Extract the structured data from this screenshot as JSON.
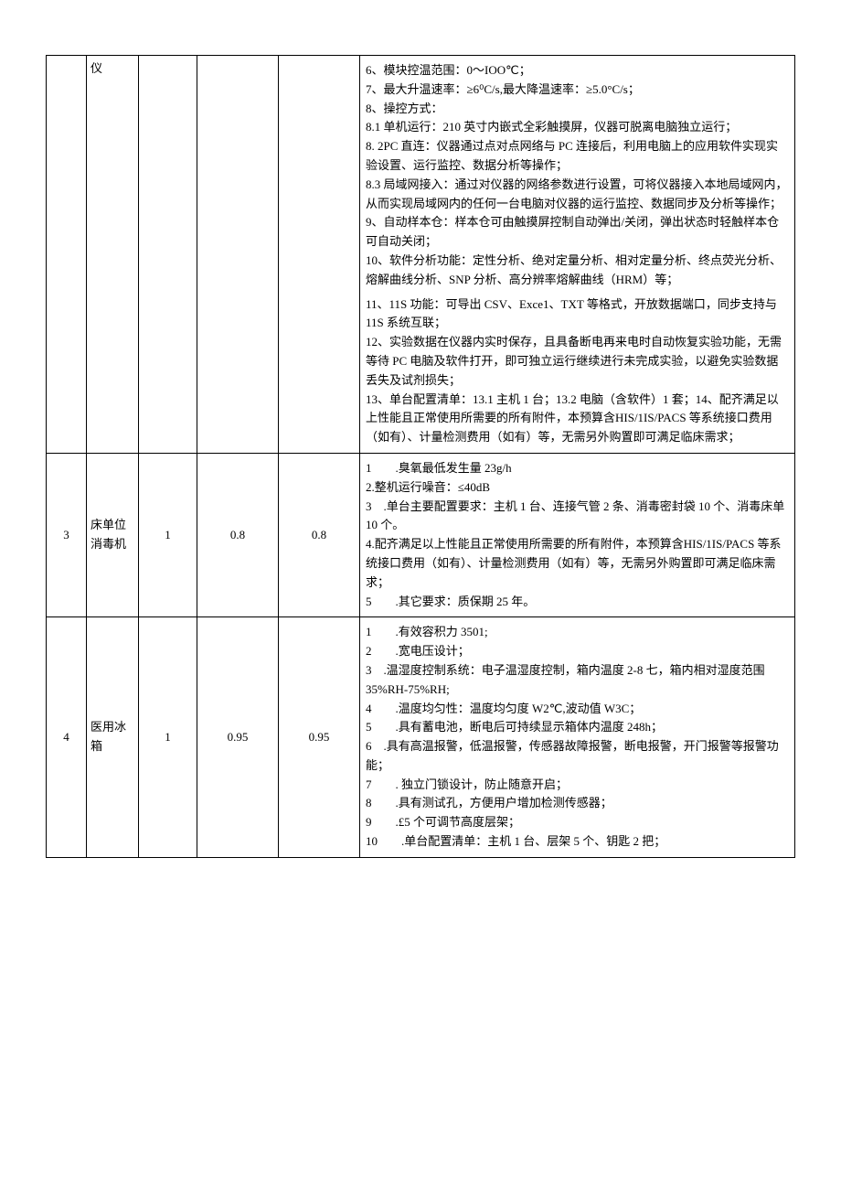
{
  "rows": [
    {
      "idx": "",
      "name": "仪",
      "qty": "",
      "p1": "",
      "p2": "",
      "spec": [
        "6、模块控温范围：0～IOO℃；",
        "7、最大升温速率：≥6⁰C/s,最大降温速率：≥5.0°C/s；",
        "8、操控方式：",
        "8.1 单机运行：210 英寸内嵌式全彩触摸屏，仪器可脱离电脑独立运行；",
        "8. 2PC 直连：仪器通过点对点网络与 PC 连接后，利用电脑上的应用软件实现实验设置、运行监控、数据分析等操作；",
        "8.3 局域网接入：通过对仪器的网络参数进行设置，可将仪器接入本地局域网内，从而实现局域网内的任何一台电脑对仪器的运行监控、数据同步及分析等操作；",
        "9、自动样本仓：样本仓可由触摸屏控制自动弹出/关闭，弹出状态时轻触样本仓可自动关闭；",
        "10、软件分析功能：定性分析、绝对定量分析、相对定量分析、终点荧光分析、熔解曲线分析、SNP 分析、高分辨率熔解曲线（HRM）等；",
        "11、11S 功能：可导出 CSV、Exce1、TXT 等格式，开放数据端口，同步支持与 11S 系统互联；",
        "12、实验数据在仪器内实时保存，且具备断电再来电时自动恢复实验功能，无需等待 PC 电脑及软件打开，即可独立运行继续进行未完成实验，以避免实验数据丢失及试剂损失；",
        "13、单台配置清单：13.1 主机 1 台；13.2 电脑（含软件）1 套；14、配齐满足以上性能且正常使用所需要的所有附件，本预算含HIS/1IS/PACS 等系统接口费用（如有）、计量检测费用（如有）等，无需另外购置即可满足临床需求；"
      ]
    },
    {
      "idx": "3",
      "name": "床单位消毒机",
      "qty": "1",
      "p1": "0.8",
      "p2": "0.8",
      "spec": [
        "1　　.臭氧最低发生量 23g/h",
        "2.整机运行噪音：≤40dB",
        "3　.单台主要配置要求：主机 1 台、连接气管 2 条、消毒密封袋 10 个、消毒床单 10 个。",
        "4.配齐满足以上性能且正常使用所需要的所有附件，本预算含HIS/1IS/PACS 等系统接口费用（如有）、计量检测费用（如有）等，无需另外购置即可满足临床需求；",
        "5　　.其它要求：质保期 25 年。"
      ]
    },
    {
      "idx": "4",
      "name": "医用冰箱",
      "qty": "1",
      "p1": "0.95",
      "p2": "0.95",
      "spec": [
        "1　　.有效容积力 3501;",
        "2　　.宽电压设计；",
        "3　.温湿度控制系统：电子温湿度控制，箱内温度 2-8 七，箱内相对湿度范围 35%RH-75%RH;",
        "4　　.温度均匀性：温度均匀度 W2℃,波动值 W3C；",
        "5　　.具有蓄电池，断电后可持续显示箱体内温度 248h；",
        "6　.具有高温报警，低温报警，传感器故障报警，断电报警，开门报警等报警功能；",
        "7　　. 独立门锁设计，防止随意开启；",
        "8　　.具有测试孔，方便用户增加检测传感器；",
        "9　　.£5 个可调节高度层架；",
        "10　　.单台配置清单：主机 1 台、层架 5 个、钥匙 2 把；"
      ]
    }
  ]
}
